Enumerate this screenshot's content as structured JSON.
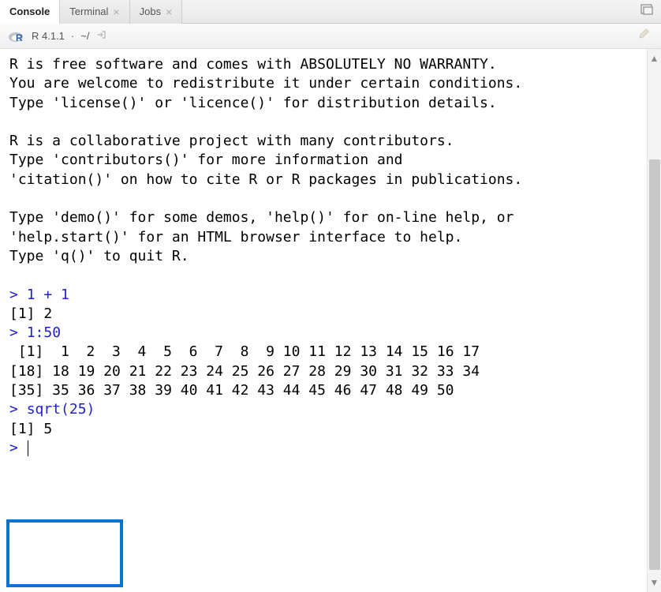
{
  "tabs": {
    "console": "Console",
    "terminal": "Terminal",
    "jobs": "Jobs"
  },
  "info": {
    "version": "R 4.1.1",
    "separator": "·",
    "path": "~/"
  },
  "console": {
    "banner_l1": "R is free software and comes with ABSOLUTELY NO WARRANTY.",
    "banner_l2": "You are welcome to redistribute it under certain conditions.",
    "banner_l3": "Type 'license()' or 'licence()' for distribution details.",
    "banner_l4": "R is a collaborative project with many contributors.",
    "banner_l5": "Type 'contributors()' for more information and",
    "banner_l6": "'citation()' on how to cite R or R packages in publications.",
    "banner_l7": "Type 'demo()' for some demos, 'help()' for on-line help, or",
    "banner_l8": "'help.start()' for an HTML browser interface to help.",
    "banner_l9": "Type 'q()' to quit R.",
    "prompt": ">",
    "cmd1": "1 + 1",
    "out1": "[1] 2",
    "cmd2": "1:50",
    "out2_l1": " [1]  1  2  3  4  5  6  7  8  9 10 11 12 13 14 15 16 17",
    "out2_l2": "[18] 18 19 20 21 22 23 24 25 26 27 28 29 30 31 32 33 34",
    "out2_l3": "[35] 35 36 37 38 39 40 41 42 43 44 45 46 47 48 49 50",
    "cmd3": "sqrt(25)",
    "out3": "[1] 5",
    "cmd4": ""
  }
}
